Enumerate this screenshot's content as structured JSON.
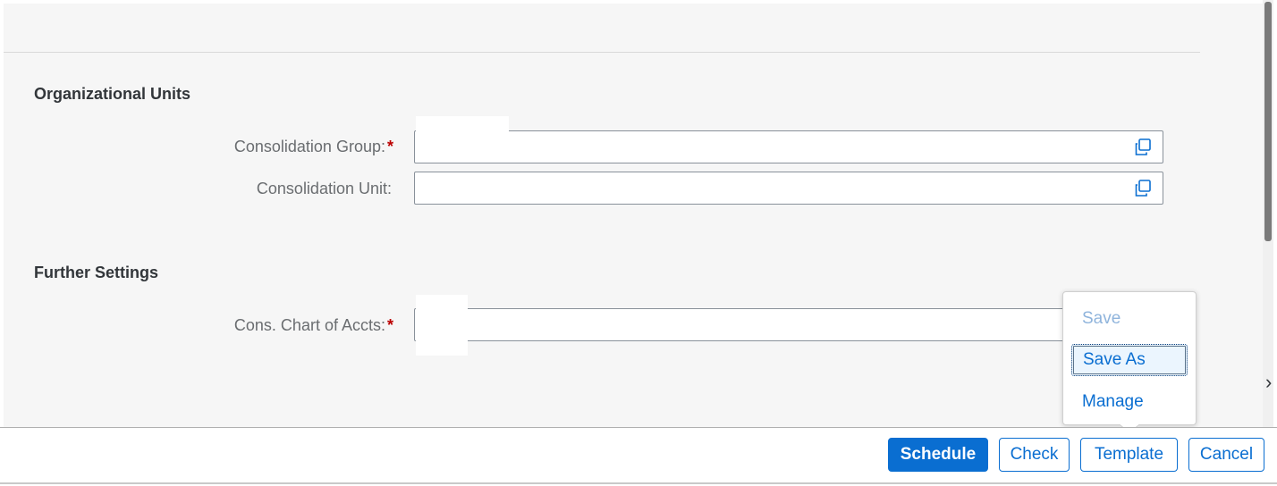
{
  "sections": {
    "organizational_units": {
      "heading": "Organizational Units",
      "fields": [
        {
          "label": "Consolidation Group:",
          "required": "*",
          "value": ""
        },
        {
          "label": "Consolidation Unit:",
          "required": "",
          "value": ""
        }
      ]
    },
    "further_settings": {
      "heading": "Further Settings",
      "fields": [
        {
          "label": "Cons. Chart of Accts:",
          "required": "*",
          "value": ""
        }
      ]
    }
  },
  "template_menu": {
    "items": [
      {
        "label": "Save",
        "state": "disabled"
      },
      {
        "label": "Save As",
        "state": "focused"
      },
      {
        "label": "Manage",
        "state": "enabled"
      }
    ]
  },
  "footer": {
    "schedule_label": "Schedule",
    "check_label": "Check",
    "template_label": "Template",
    "cancel_label": "Cancel"
  },
  "colors": {
    "accent": "#0a6ed1",
    "required": "#bb0000",
    "background": "#f6f6f6"
  },
  "icons": {
    "value_help": "value-help-icon",
    "scroll_indicator": "chevron-right-icon"
  }
}
